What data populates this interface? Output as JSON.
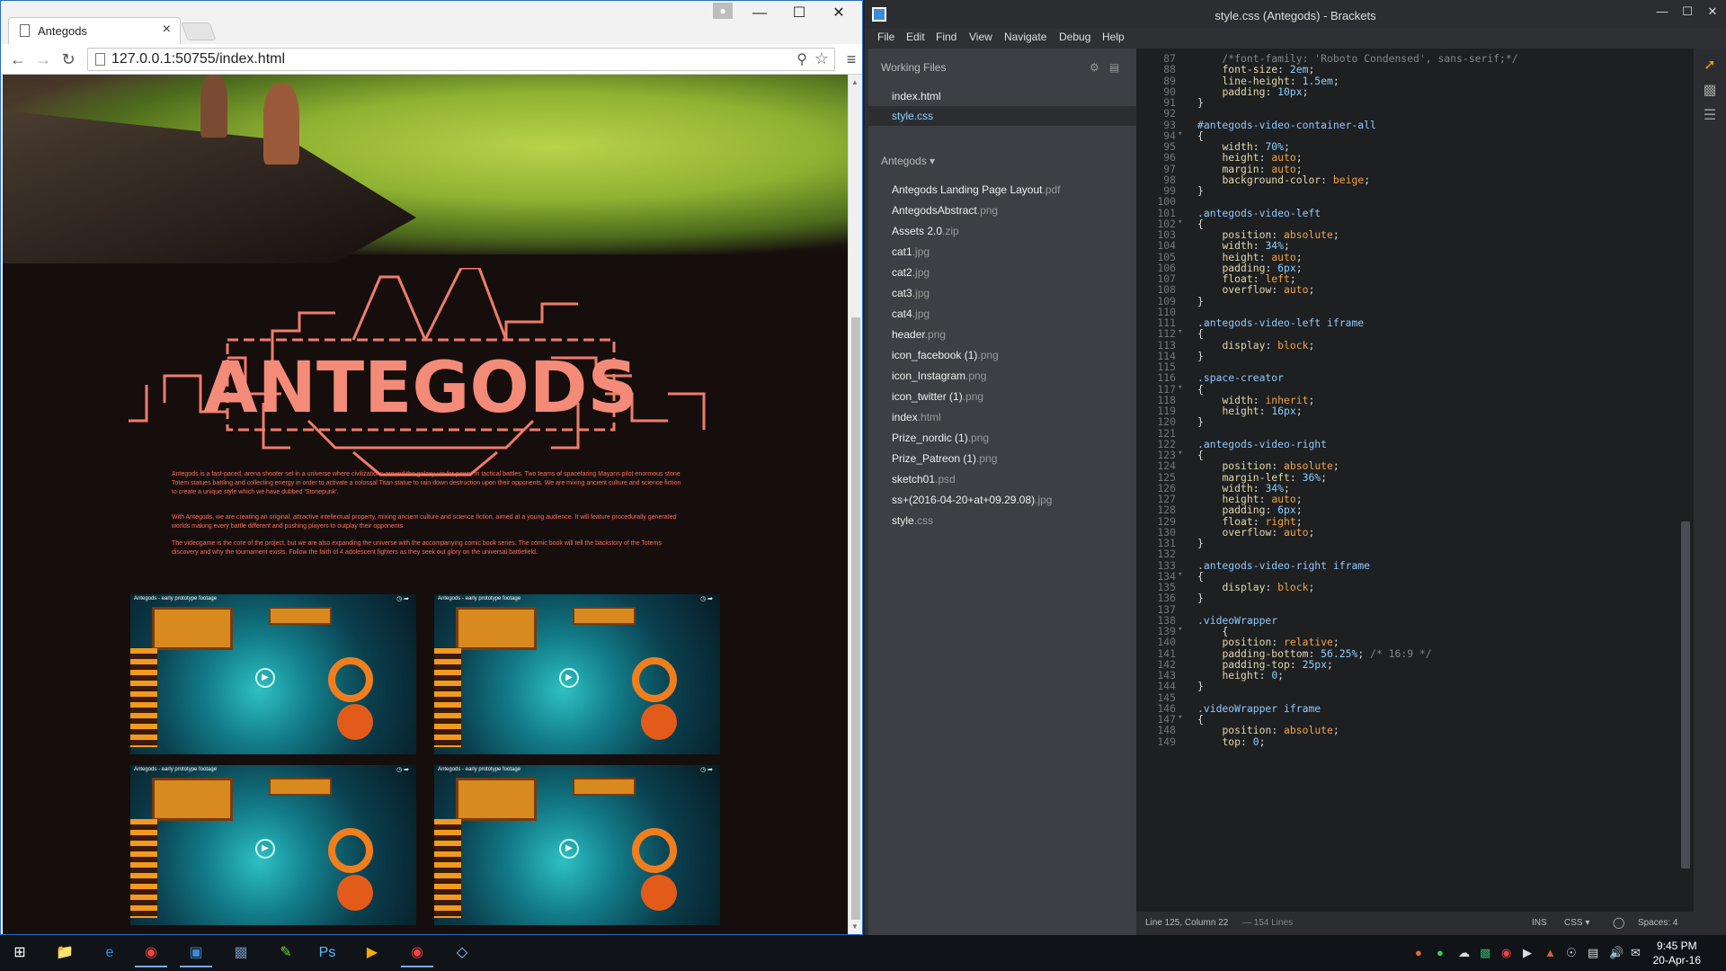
{
  "chrome": {
    "tab_title": "Antegods",
    "tab_close": "×",
    "url": "127.0.0.1:50755/index.html",
    "minimize": "—",
    "maximize": "☐",
    "close": "✕",
    "back": "←",
    "forward": "→",
    "reload": "↻",
    "zoom": "⚲",
    "star": "☆",
    "menu": "≡"
  },
  "webpage": {
    "logo_text": "ANTEGODS",
    "paragraphs": [
      "Antegods is a fast-paced, arena shooter set in a universe where civilizations around the galaxy vie for power in tactical battles. Two teams of spacefaring Mayans pilot enormous stone Totem statues battling and collecting energy in order to activate a colossal Titan statue to rain down destruction upon their opponents. We are mixing ancient culture and science fiction to create a unique style which we have dubbed 'Stonepunk'.",
      "With Antegods, we are creating an original, attractive intellectual property, mixing ancient culture and science fiction, aimed at a young audience. It will feature procedurally generated worlds making every battle different and pushing players to outplay their opponents.",
      "The videogame is the core of the project, but we are also expanding the universe with the accompanying comic book series. The comic book will tell the backstory of the Totems discovery and why the tournament exists. Follow the faith of 4 adolescent fighters as they seek out glory on the universal battlefield."
    ],
    "videos": [
      {
        "title": "Antegods - early prototype footage"
      },
      {
        "title": "Antegods - early prototype footage"
      },
      {
        "title": "Antegods - early prototype footage"
      },
      {
        "title": "Antegods - early prototype footage"
      }
    ]
  },
  "brackets": {
    "window_title": "style.css (Antegods) - Brackets",
    "menu": [
      "File",
      "Edit",
      "Find",
      "View",
      "Navigate",
      "Debug",
      "Help"
    ],
    "working_files_header": "Working Files",
    "working_files": [
      "index.html",
      "style.css"
    ],
    "project_title": "Antegods ▾",
    "files": [
      {
        "name": "Antegods Landing Page Layout",
        "ext": ".pdf"
      },
      {
        "name": "AntegodsAbstract",
        "ext": ".png"
      },
      {
        "name": "Assets 2.0",
        "ext": ".zip"
      },
      {
        "name": "cat1",
        "ext": ".jpg"
      },
      {
        "name": "cat2",
        "ext": ".jpg"
      },
      {
        "name": "cat3",
        "ext": ".jpg"
      },
      {
        "name": "cat4",
        "ext": ".jpg"
      },
      {
        "name": "header",
        "ext": ".png"
      },
      {
        "name": "icon_facebook (1)",
        "ext": ".png"
      },
      {
        "name": "icon_Instagram",
        "ext": ".png"
      },
      {
        "name": "icon_twitter (1)",
        "ext": ".png"
      },
      {
        "name": "index",
        "ext": ".html"
      },
      {
        "name": "Prize_nordic (1)",
        "ext": ".png"
      },
      {
        "name": "Prize_Patreon (1)",
        "ext": ".png"
      },
      {
        "name": "sketch01",
        "ext": ".psd"
      },
      {
        "name": "ss+(2016-04-20+at+09.29.08)",
        "ext": ".jpg"
      },
      {
        "name": "style",
        "ext": ".css"
      }
    ],
    "code_start_line": 87,
    "code_lines": [
      "    /*font-family: 'Roboto Condensed', sans-serif;*/",
      "    font-size: 2em;",
      "    line-height: 1.5em;",
      "    padding: 10px;",
      "}",
      "",
      "#antegods-video-container-all",
      "{",
      "    width: 70%;",
      "    height: auto;",
      "    margin: auto;",
      "    background-color: beige;",
      "}",
      "",
      ".antegods-video-left",
      "{",
      "    position: absolute;",
      "    width: 34%;",
      "    height: auto;",
      "    padding: 6px;",
      "    float: left;",
      "    overflow: auto;",
      "}",
      "",
      ".antegods-video-left iframe",
      "{",
      "    display: block;",
      "}",
      "",
      ".space-creator",
      "{",
      "    width: inherit;",
      "    height: 16px;",
      "}",
      "",
      ".antegods-video-right",
      "{",
      "    position: absolute;",
      "    margin-left: 36%;",
      "    width: 34%;",
      "    height: auto;",
      "    padding: 6px;",
      "    float: right;",
      "    overflow: auto;",
      "}",
      "",
      ".antegods-video-right iframe",
      "{",
      "    display: block;",
      "}",
      "",
      ".videoWrapper",
      "    {",
      "    position: relative;",
      "    padding-bottom: 56.25%; /* 16:9 */",
      "    padding-top: 25px;",
      "    height: 0;",
      "}",
      "",
      ".videoWrapper iframe",
      "{",
      "    position: absolute;",
      "    top: 0;"
    ],
    "fold_lines": [
      94,
      102,
      112,
      117,
      123,
      134,
      139,
      147
    ],
    "status": {
      "cursor": "Line 125, Column 22",
      "lines": "— 154 Lines",
      "ins": "INS",
      "mode": "CSS ▾",
      "spaces": "Spaces: 4"
    }
  },
  "taskbar": {
    "time": "9:45 PM",
    "date": "20-Apr-16"
  }
}
